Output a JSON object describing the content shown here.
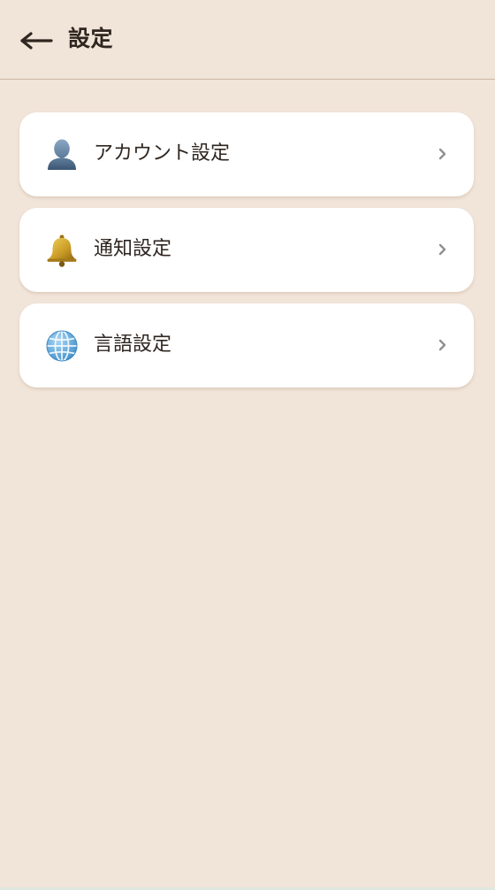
{
  "header": {
    "title": "設定"
  },
  "settings": [
    {
      "label": "アカウント設定",
      "icon": "user-silhouette-icon"
    },
    {
      "label": "通知設定",
      "icon": "bell-icon"
    },
    {
      "label": "言語設定",
      "icon": "globe-icon"
    }
  ],
  "colors": {
    "background": "#f1e4d8",
    "card": "#ffffff",
    "text": "#2f2620",
    "divider": "#cdb6a3",
    "chevron": "#8f8f8f"
  }
}
